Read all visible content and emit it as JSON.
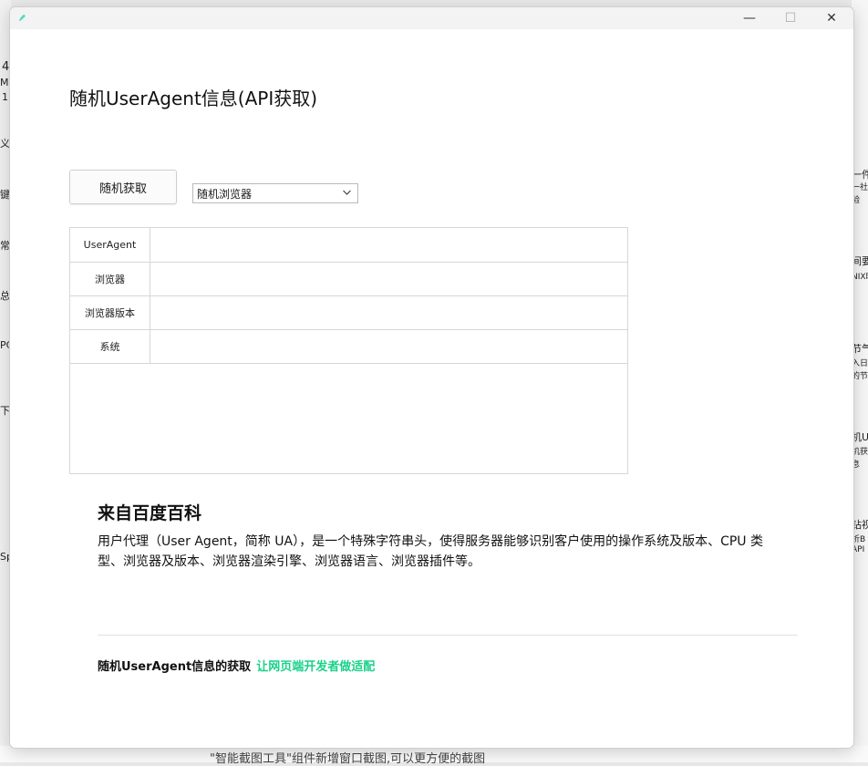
{
  "window": {
    "title": "随机UserAgent信息(API获取)",
    "controls": {
      "minimize": "—",
      "maximize": "☐",
      "close": "✕"
    }
  },
  "toolbar": {
    "random_button": "随机获取",
    "browser_select": {
      "value": "随机浏览器"
    }
  },
  "table": {
    "rows": [
      {
        "label": "UserAgent",
        "value": ""
      },
      {
        "label": "浏览器",
        "value": ""
      },
      {
        "label": "浏览器版本",
        "value": ""
      },
      {
        "label": "系统",
        "value": ""
      }
    ]
  },
  "about": {
    "title": "来自百度百科",
    "body": "用户代理（User Agent，简称 UA），是一个特殊字符串头，使得服务器能够识别客户使用的操作系统及版本、CPU 类型、浏览器及版本、浏览器渲染引擎、浏览器语言、浏览器插件等。"
  },
  "footer": {
    "text": "随机UserAgent信息的获取",
    "accent": "让网页端开发者做适配"
  },
  "background": {
    "left": [
      "4",
      "Mic",
      "1",
      "义",
      "键件",
      "常用",
      "总统",
      "PC",
      "下",
      "Sp"
    ],
    "right": [
      "一件",
      "一社",
      "验",
      "间要",
      "NIX时",
      "节气",
      "入日",
      "的节",
      "机U",
      "机获",
      "息",
      "钻视",
      "析B",
      "API"
    ],
    "bottom": "\"智能截图工具\"组件新增窗口截图,可以更方便的截图"
  },
  "colors": {
    "accent": "#1bd18a",
    "app_icon": "#2fd2b0"
  },
  "icons": {
    "app": "app-icon",
    "dropdown": "chevron-down-icon"
  }
}
